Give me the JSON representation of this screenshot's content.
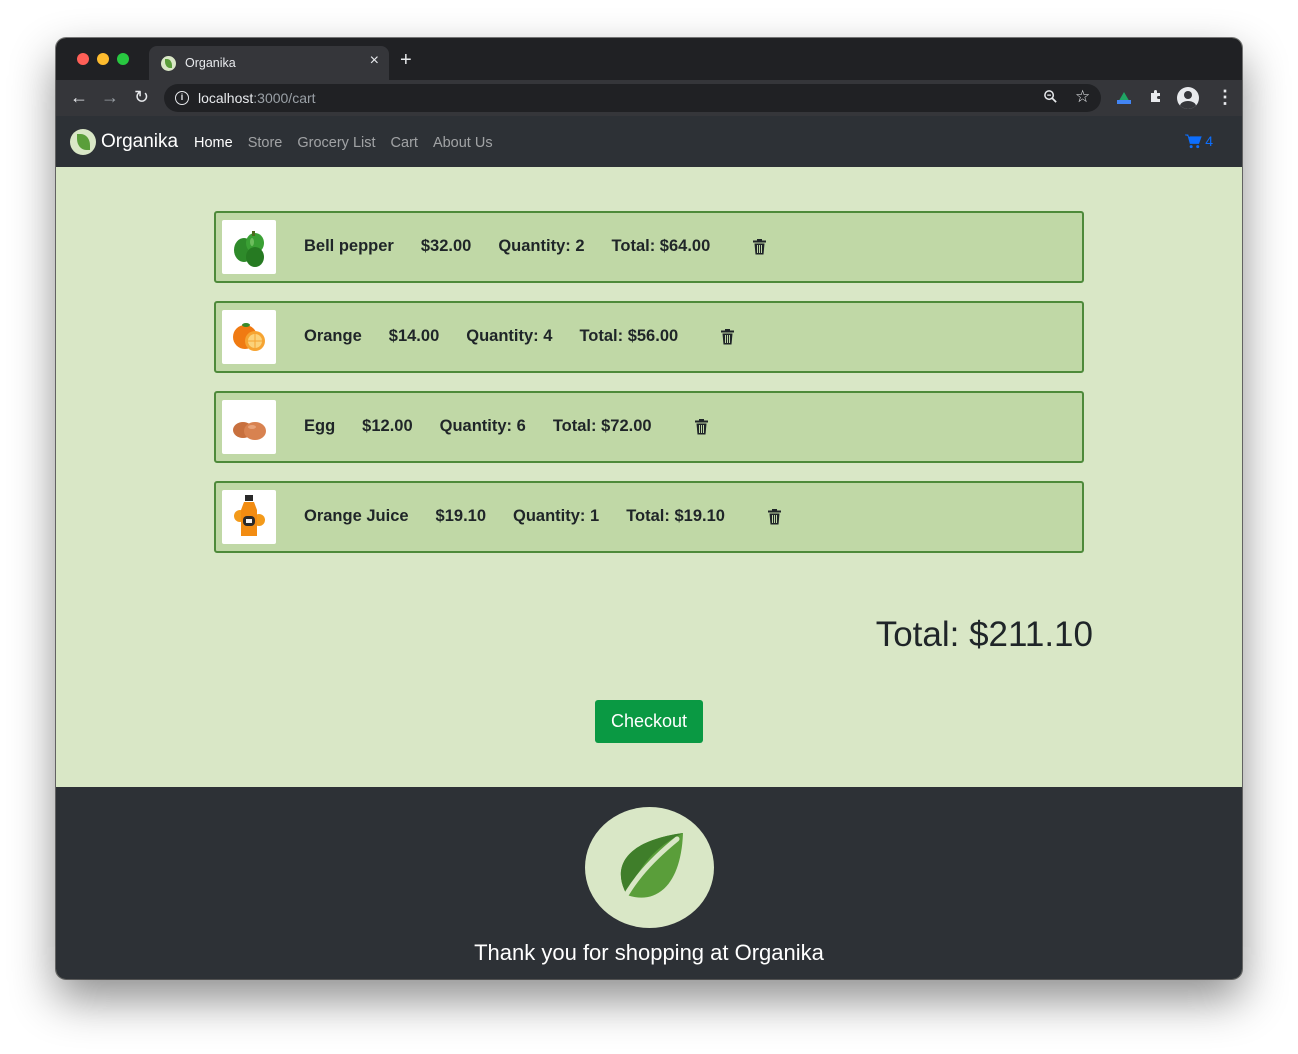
{
  "browser": {
    "tab_title": "Organika",
    "tab_close": "×",
    "new_tab": "+",
    "url_host": "localhost",
    "url_path": ":3000/cart"
  },
  "navbar": {
    "brand": "Organika",
    "links": [
      "Home",
      "Store",
      "Grocery List",
      "Cart",
      "About Us"
    ],
    "active_link": "Home",
    "cart_count": "4",
    "cart_color": "#0d6efd"
  },
  "cart": {
    "items": [
      {
        "name": "Bell pepper",
        "price": "$32.00",
        "quantity": "Quantity: 2",
        "total": "Total: $64.00",
        "icon": "bell-pepper"
      },
      {
        "name": "Orange",
        "price": "$14.00",
        "quantity": "Quantity: 4",
        "total": "Total: $56.00",
        "icon": "orange"
      },
      {
        "name": "Egg",
        "price": "$12.00",
        "quantity": "Quantity: 6",
        "total": "Total: $72.00",
        "icon": "egg"
      },
      {
        "name": "Orange Juice",
        "price": "$19.10",
        "quantity": "Quantity: 1",
        "total": "Total: $19.10",
        "icon": "orange-juice"
      }
    ],
    "grand_total": "Total: $211.10",
    "checkout_label": "Checkout"
  },
  "footer": {
    "tagline": "Thank you for shopping at Organika"
  },
  "colors": {
    "page_bg": "#d9e7c6",
    "item_bg": "#c0d8a6",
    "item_border": "#4e8a3a",
    "nav_bg": "#2d3136",
    "checkout": "#0a9943",
    "leaf": "#5a9e3a"
  }
}
